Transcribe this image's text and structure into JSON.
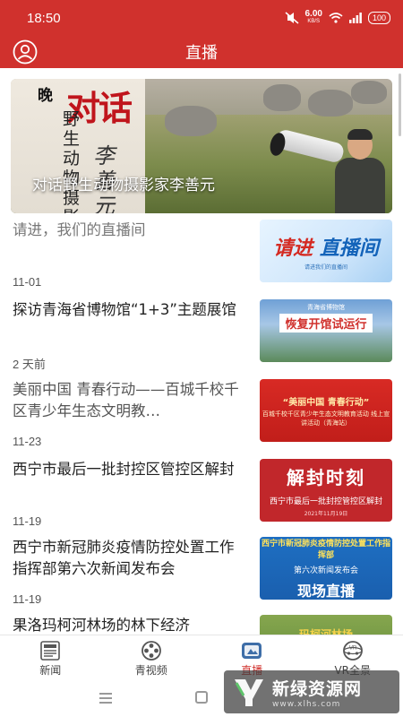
{
  "status_bar": {
    "time": "18:50",
    "net_speed": "6.00",
    "net_unit": "KB/S",
    "battery": "100"
  },
  "header": {
    "title": "直播",
    "user_icon": "user-icon"
  },
  "hero": {
    "caption": "对话野生动物摄影家李善元",
    "art_small": "晚",
    "art_title": "对话",
    "art_vertical": "野生动物摄影",
    "art_signature": "李善元"
  },
  "news": [
    {
      "title": "请进，我们的直播间",
      "date": "11-01",
      "thumb_title": "请进",
      "thumb_title2": "直播间",
      "thumb_sub": "请进我们的直播间",
      "thumb_caption": ""
    },
    {
      "title": "探访青海省博物馆“1+3”主题展馆",
      "date": "2 天前",
      "thumb_title": "恢复开馆试运行",
      "thumb_sub": "青海省博物馆",
      "thumb_caption": ""
    },
    {
      "title": "美丽中国 青春行动——百城千校千区青少年生态文明教…",
      "date": "11-23",
      "thumb_title": "“美丽中国 青春行动”",
      "thumb_sub": "百城千校千区青少年生态文明教育活动 线上宣讲活动（青海站）",
      "thumb_caption": ""
    },
    {
      "title": "西宁市最后一批封控区管控区解封",
      "date": "11-19",
      "thumb_title": "解封时刻",
      "thumb_sub": "西宁市最后一批封控管控区解封",
      "thumb_caption": "2021年11月19日"
    },
    {
      "title": "西宁市新冠肺炎疫情防控处置工作指挥部第六次新闻发布会",
      "date": "11-19",
      "thumb_title": "现场直播",
      "thumb_sub": "第六次新闻发布会",
      "thumb_caption": "西宁市新冠肺炎疫情防控处置工作指挥部"
    },
    {
      "title": "果洛玛柯河林场的林下经济",
      "date": "",
      "thumb_title": "玛柯河林场",
      "thumb_sub": "",
      "thumb_caption": ""
    }
  ],
  "tabs": [
    {
      "label": "新闻",
      "icon": "newspaper-icon",
      "active": false
    },
    {
      "label": "青视频",
      "icon": "film-reel-icon",
      "active": false
    },
    {
      "label": "直播",
      "icon": "live-tv-icon",
      "active": true
    },
    {
      "label": "VR全景",
      "icon": "vr-panorama-icon",
      "active": false
    }
  ],
  "watermark": {
    "text": "新绿资源网",
    "url": "www.xlhs.com"
  },
  "colors": {
    "brand_red": "#d0312d",
    "tab_active": "#d0312d",
    "tab_inactive": "#444444"
  }
}
